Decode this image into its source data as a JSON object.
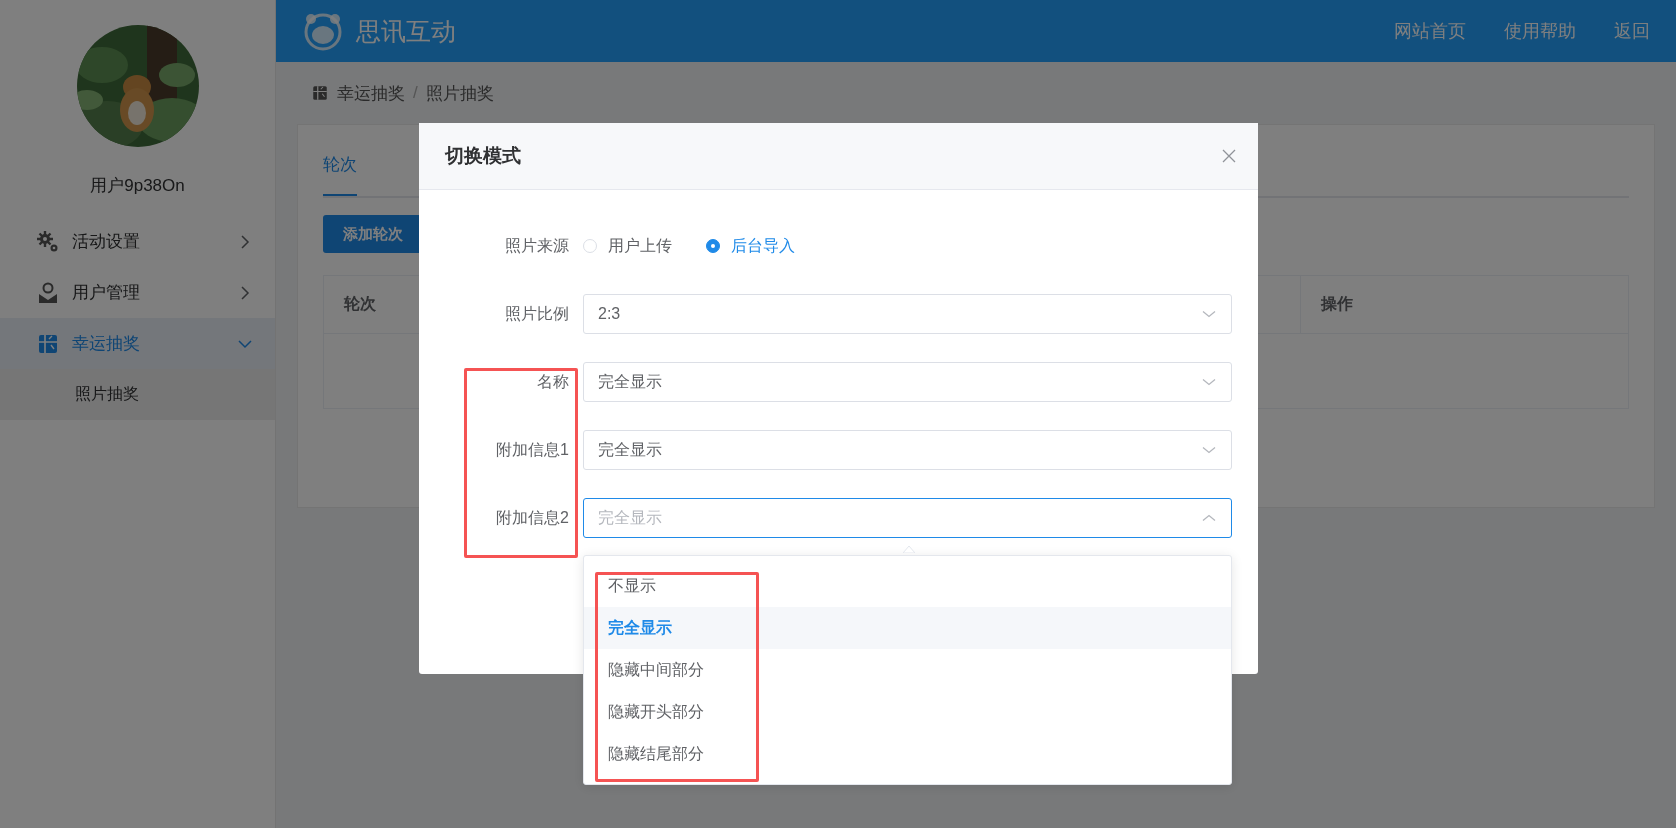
{
  "header": {
    "title": "思讯互动",
    "links": [
      "网站首页",
      "使用帮助",
      "返回"
    ]
  },
  "sidebar": {
    "user_name": "用户9p38On",
    "items": [
      {
        "label": "活动设置",
        "selected": false,
        "expanded": false
      },
      {
        "label": "用户管理",
        "selected": false,
        "expanded": false
      },
      {
        "label": "幸运抽奖",
        "selected": true,
        "expanded": true,
        "children": [
          {
            "label": "照片抽奖",
            "selected": false
          }
        ]
      }
    ]
  },
  "breadcrumb": {
    "items": [
      "幸运抽奖",
      "照片抽奖"
    ],
    "separator": "/"
  },
  "card": {
    "tabs": [
      {
        "label": "轮次",
        "selected": true
      }
    ],
    "add_button": "添加轮次",
    "table": {
      "columns": [
        "轮次",
        "操作"
      ]
    }
  },
  "dialog": {
    "title": "切换模式",
    "labels_outlined": true,
    "fields": [
      {
        "kind": "radio",
        "label": "照片来源",
        "options": [
          {
            "label": "用户上传",
            "selected": false
          },
          {
            "label": "后台导入",
            "selected": true
          }
        ]
      },
      {
        "kind": "select",
        "label": "照片比例",
        "value": "2:3",
        "expanded": false
      },
      {
        "kind": "select",
        "label": "名称",
        "value": "完全显示",
        "expanded": false
      },
      {
        "kind": "select",
        "label": "附加信息1",
        "value": "完全显示",
        "expanded": false
      },
      {
        "kind": "select",
        "label": "附加信息2",
        "placeholder": "完全显示",
        "expanded": true,
        "options_outlined": true,
        "options": [
          {
            "label": "不显示",
            "selected": false
          },
          {
            "label": "完全显示",
            "selected": true
          },
          {
            "label": "隐藏中间部分",
            "selected": false
          },
          {
            "label": "隐藏开头部分",
            "selected": false
          },
          {
            "label": "隐藏结尾部分",
            "selected": false
          }
        ]
      }
    ]
  }
}
